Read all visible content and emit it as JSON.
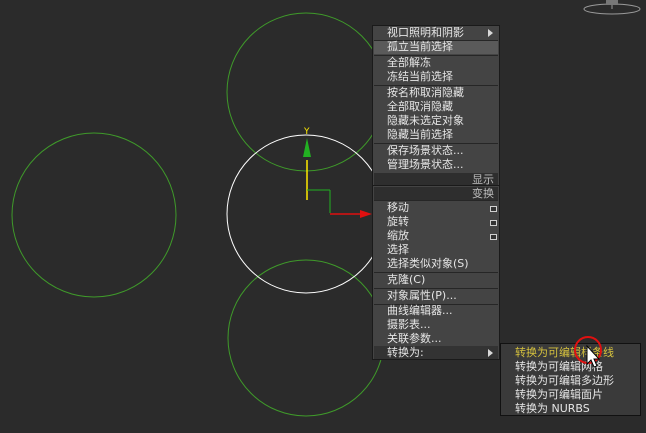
{
  "quad_menu": {
    "top_items": [
      {
        "label": "视口照明和阴影",
        "has_submenu": true
      },
      {
        "label": "孤立当前选择"
      },
      {
        "label": "全部解冻"
      },
      {
        "label": "冻结当前选择"
      },
      {
        "label": "按名称取消隐藏"
      },
      {
        "label": "全部取消隐藏"
      },
      {
        "label": "隐藏未选定对象"
      },
      {
        "label": "隐藏当前选择"
      },
      {
        "label": "保存场景状态..."
      },
      {
        "label": "管理场景状态..."
      }
    ],
    "display_header": "显示",
    "transform_header": "变换",
    "bottom_items": [
      {
        "label": "移动",
        "has_options": true
      },
      {
        "label": "旋转",
        "has_options": true
      },
      {
        "label": "缩放",
        "has_options": true
      },
      {
        "label": "选择"
      },
      {
        "label": "选择类似对象(S)"
      },
      {
        "label": "克隆(C)"
      },
      {
        "label": "对象属性(P)..."
      },
      {
        "label": "曲线编辑器..."
      },
      {
        "label": "摄影表..."
      },
      {
        "label": "关联参数..."
      },
      {
        "label": "转换为:",
        "has_submenu": true
      }
    ]
  },
  "convert_submenu": {
    "items": [
      {
        "label": "转换为可编辑样条线",
        "active": true
      },
      {
        "label": "转换为可编辑网格"
      },
      {
        "label": "转换为可编辑多边形"
      },
      {
        "label": "转换为可编辑面片"
      },
      {
        "label": "转换为 NURBS"
      }
    ]
  },
  "gizmo": {
    "y_axis_label": "Y"
  },
  "colors": {
    "viewport_bg": "#2b2b2b",
    "circle_unselected": "#3f9a2a",
    "circle_selected": "#ffffff",
    "axis_y": "#22b022",
    "axis_x": "#e01010",
    "gizmo_yellow": "#ffea00",
    "cursor_marker": "#e01010",
    "menu_active_text": "#d6c23e"
  },
  "icons": {
    "cursor": "arrow-cursor-icon",
    "submenu": "triangle-right-icon",
    "options": "settings-box-icon"
  }
}
